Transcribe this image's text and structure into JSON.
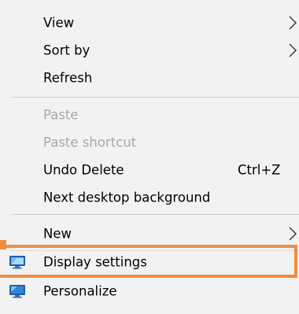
{
  "context_menu": {
    "items": [
      {
        "label": "View",
        "submenu": true,
        "enabled": true
      },
      {
        "label": "Sort by",
        "submenu": true,
        "enabled": true
      },
      {
        "label": "Refresh",
        "submenu": false,
        "enabled": true
      },
      {
        "label": "Paste",
        "submenu": false,
        "enabled": false
      },
      {
        "label": "Paste shortcut",
        "submenu": false,
        "enabled": false
      },
      {
        "label": "Undo Delete",
        "shortcut": "Ctrl+Z",
        "submenu": false,
        "enabled": true
      },
      {
        "label": "Next desktop background",
        "submenu": false,
        "enabled": true
      },
      {
        "label": "New",
        "submenu": true,
        "enabled": true
      },
      {
        "label": "Display settings",
        "icon": "display-settings-icon",
        "submenu": false,
        "enabled": true,
        "highlighted": true
      },
      {
        "label": "Personalize",
        "icon": "personalize-icon",
        "submenu": false,
        "enabled": true
      }
    ]
  },
  "colors": {
    "menu_background": "#f2f2f2",
    "disabled_text": "#a8a8a8",
    "highlight_outline": "#ef8e3b"
  }
}
